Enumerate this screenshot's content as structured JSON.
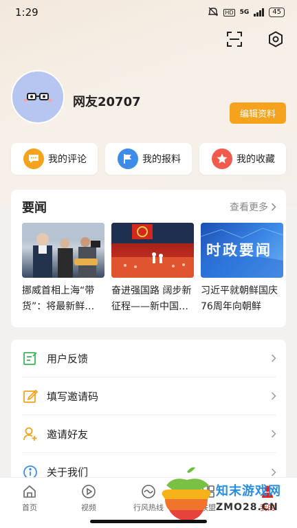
{
  "status": {
    "time": "1:29",
    "network": "5G",
    "hd": "HD",
    "battery": "45"
  },
  "profile": {
    "username": "网友20707",
    "edit_label": "编辑资料"
  },
  "quick_actions": [
    {
      "label": "我的评论",
      "icon": "comment-icon",
      "color": "#f5a31d"
    },
    {
      "label": "我的报料",
      "icon": "flag-icon",
      "color": "#3d8de8"
    },
    {
      "label": "我的收藏",
      "icon": "star-icon",
      "color": "#f25b4b"
    }
  ],
  "news": {
    "title": "要闻",
    "more_label": "查看更多",
    "items": [
      {
        "text": "挪威首相上海“带货”：将最新鲜…"
      },
      {
        "text": "奋进强国路 阔步新征程——新中国…"
      },
      {
        "text": "习近平就朝鲜国庆76周年向朝鲜",
        "image_text": "时政要闻"
      }
    ]
  },
  "settings": [
    {
      "label": "用户反馈",
      "icon": "feedback-icon",
      "color": "#3cb55a"
    },
    {
      "label": "填写邀请码",
      "icon": "edit-icon",
      "color": "#f5a31d"
    },
    {
      "label": "邀请好友",
      "icon": "invite-user-icon",
      "color": "#f5a31d"
    },
    {
      "label": "关于我们",
      "icon": "info-icon",
      "color": "#3d8de8"
    }
  ],
  "nav": [
    {
      "label": "首页",
      "icon": "home-icon"
    },
    {
      "label": "视频",
      "icon": "play-icon"
    },
    {
      "label": "行风热线",
      "icon": "hotline-icon"
    },
    {
      "label": "联盟",
      "icon": "alliance-icon"
    },
    {
      "label": "我的",
      "icon": "profile-icon",
      "active": true
    }
  ],
  "watermark": {
    "line1": "知末游戏网",
    "line2": "ZMO28.CN"
  }
}
